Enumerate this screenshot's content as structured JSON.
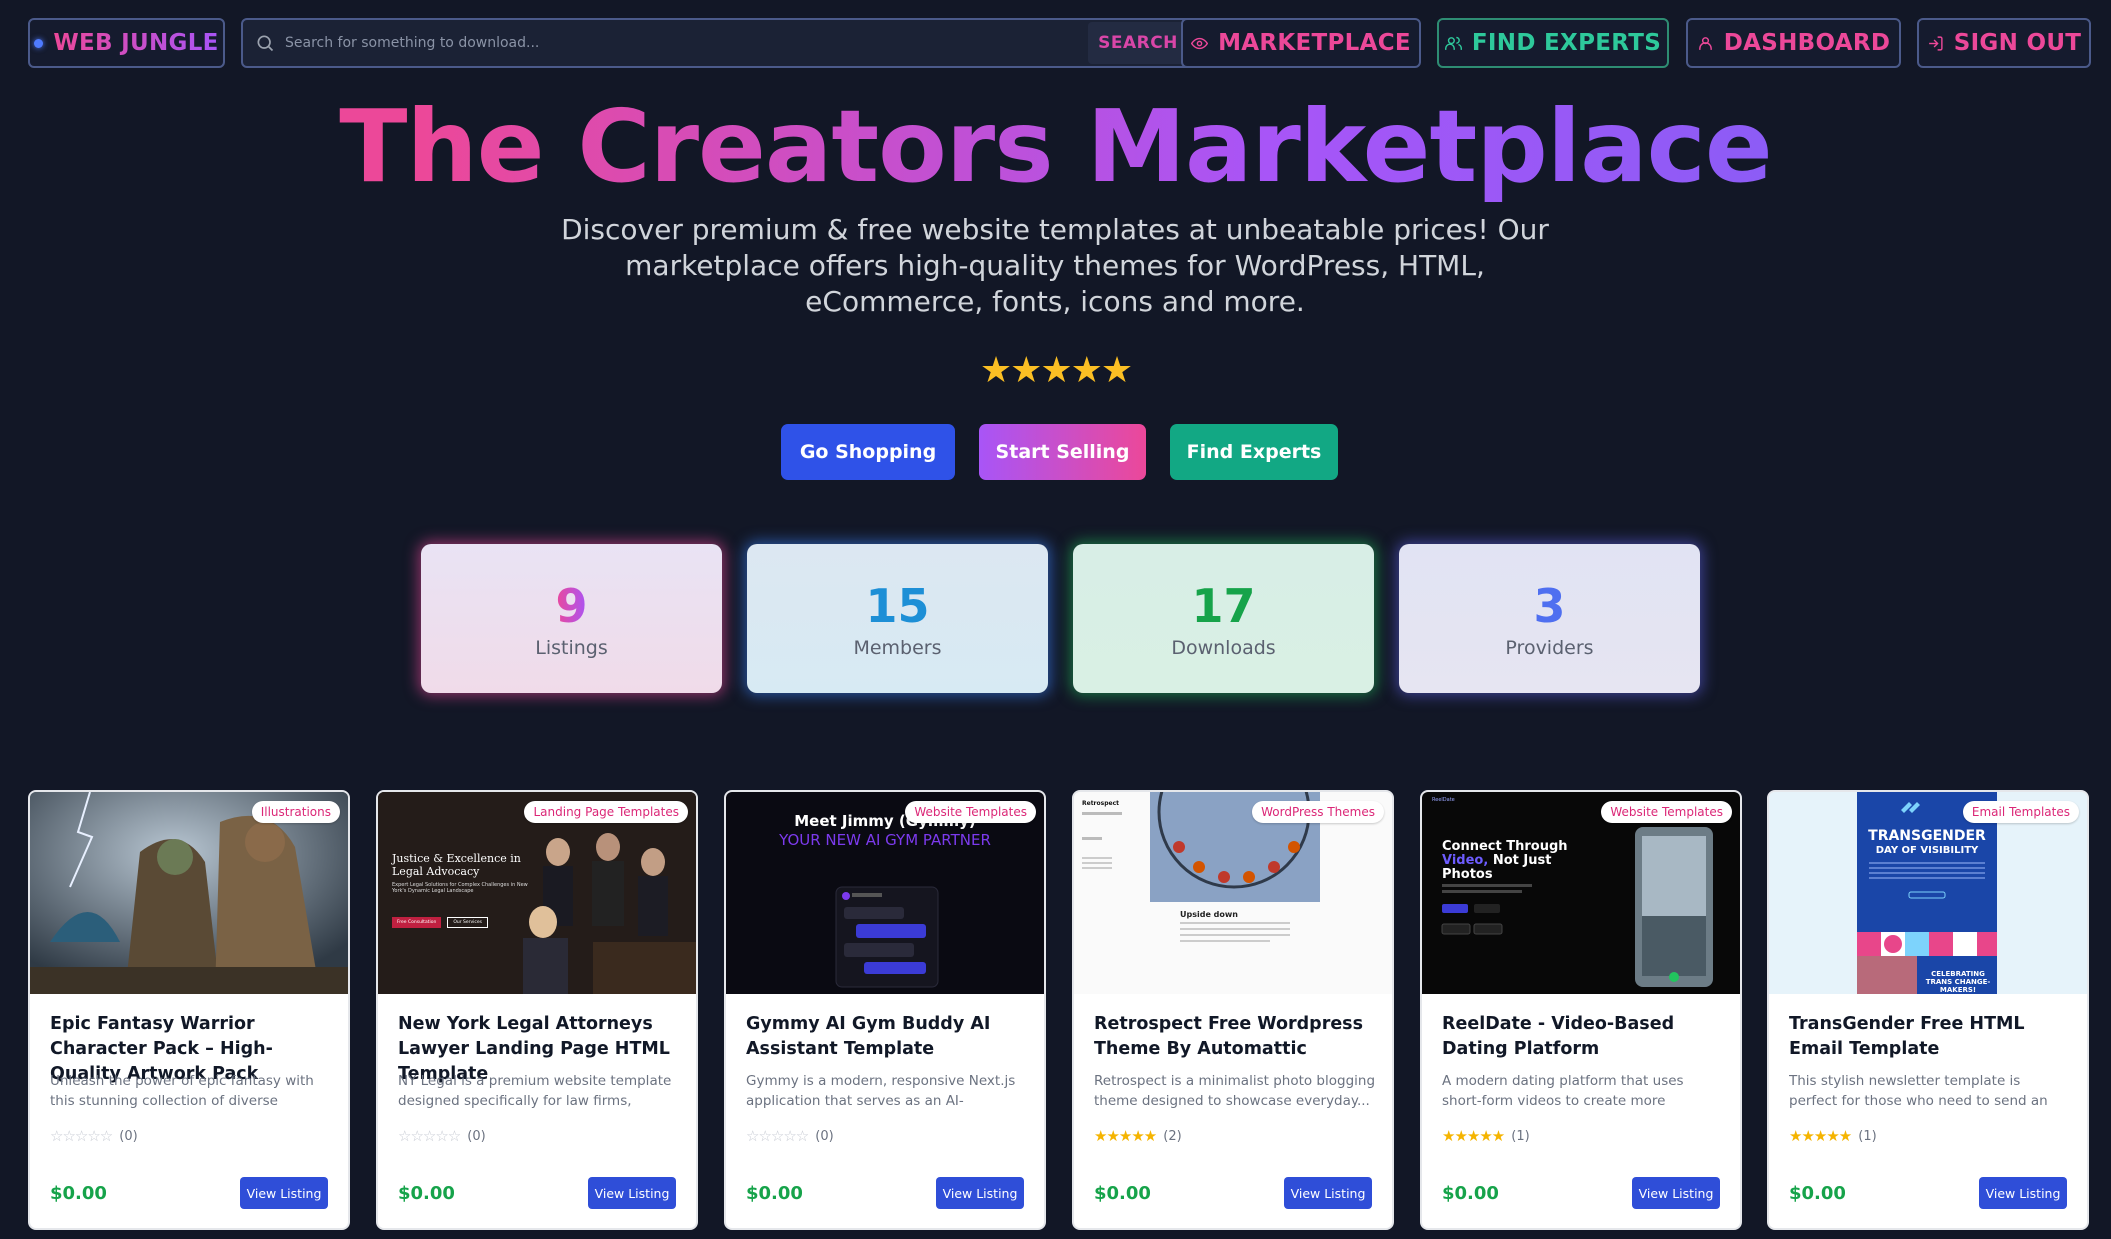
{
  "nav": {
    "logo": "WEB JUNGLE",
    "search_placeholder": "Search for something to download...",
    "search_button": "SEARCH",
    "marketplace": "MARKETPLACE",
    "find_experts": "FIND EXPERTS",
    "dashboard": "DASHBOARD",
    "sign_out": "SIGN OUT"
  },
  "hero": {
    "title": "The Creators Marketplace",
    "subtitle": "Discover premium & free website templates at unbeatable prices! Our marketplace offers high-quality themes for WordPress, HTML, eCommerce, fonts, icons and more.",
    "stars": "★★★★★",
    "cta_shop": "Go Shopping",
    "cta_sell": "Start Selling",
    "cta_experts": "Find Experts"
  },
  "stats": [
    {
      "value": "9",
      "label": "Listings"
    },
    {
      "value": "15",
      "label": "Members"
    },
    {
      "value": "17",
      "label": "Downloads"
    },
    {
      "value": "3",
      "label": "Providers"
    }
  ],
  "colors": {
    "background": "#121726",
    "pink": "#ec4899",
    "purple": "#a855f7",
    "teal": "#2ec99b",
    "blue": "#2f52e8",
    "price_green": "#16a34a"
  },
  "listings": [
    {
      "category": "Illustrations",
      "title": "Epic Fantasy Warrior Character Pack – High-Quality Artwork Pack",
      "description": "Unleash the power of epic fantasy with this stunning collection of diverse warrior...",
      "stars": "☆☆☆☆☆",
      "rating": 0,
      "count": "(0)",
      "price": "$0.00",
      "button": "View Listing"
    },
    {
      "category": "Landing Page Templates",
      "title": "New York Legal Attorneys Lawyer Landing Page HTML Template",
      "description": "NY Legal is a premium website template designed specifically for law firms, legal...",
      "stars": "☆☆☆☆☆",
      "rating": 0,
      "count": "(0)",
      "price": "$0.00",
      "button": "View Listing",
      "thumb_heading": "Justice & Excellence in Legal Advocacy",
      "thumb_sub": "Expert Legal Solutions for Complex Challenges in New York's Dynamic Legal Landscape",
      "thumb_btn1": "Free Consultation",
      "thumb_btn2": "Our Services"
    },
    {
      "category": "Website Templates",
      "title": "Gymmy AI Gym Buddy AI Assistant Template",
      "description": "Gymmy is a modern, responsive Next.js application that serves as an AI-powered...",
      "stars": "☆☆☆☆☆",
      "rating": 0,
      "count": "(0)",
      "price": "$0.00",
      "button": "View Listing",
      "thumb_heading": "Meet Jimmy (Gymmy)",
      "thumb_sub": "YOUR NEW AI GYM PARTNER"
    },
    {
      "category": "WordPress Themes",
      "title": "Retrospect Free Wordpress Theme By Automattic",
      "description": "Retrospect is a minimalist photo blogging theme designed to showcase everyday...",
      "stars": "★★★★★",
      "rating": 5,
      "count": "(2)",
      "price": "$0.00",
      "button": "View Listing",
      "thumb_brand": "Retrospect",
      "thumb_caption": "Upside down"
    },
    {
      "category": "Website Templates",
      "title": "ReelDate - Video-Based Dating Platform",
      "description": "A modern dating platform that uses short-form videos to create more authentic...",
      "stars": "★★★★★",
      "rating": 5,
      "count": "(1)",
      "price": "$0.00",
      "button": "View Listing",
      "thumb_brand": "ReelDate",
      "thumb_heading_1": "Connect Through",
      "thumb_heading_2": "Video,",
      "thumb_heading_3": "Not Just Photos"
    },
    {
      "category": "Email Templates",
      "title": "TransGender Free HTML Email Template",
      "description": "This stylish newsletter template is perfect for those who need to send an impactful email.",
      "stars": "★★★★★",
      "rating": 5,
      "count": "(1)",
      "price": "$0.00",
      "button": "View Listing",
      "thumb_heading": "TRANSGENDER",
      "thumb_sub": "DAY OF VISIBILITY",
      "thumb_footer": "CELEBRATING TRANS CHANGE-MAKERS!"
    }
  ]
}
